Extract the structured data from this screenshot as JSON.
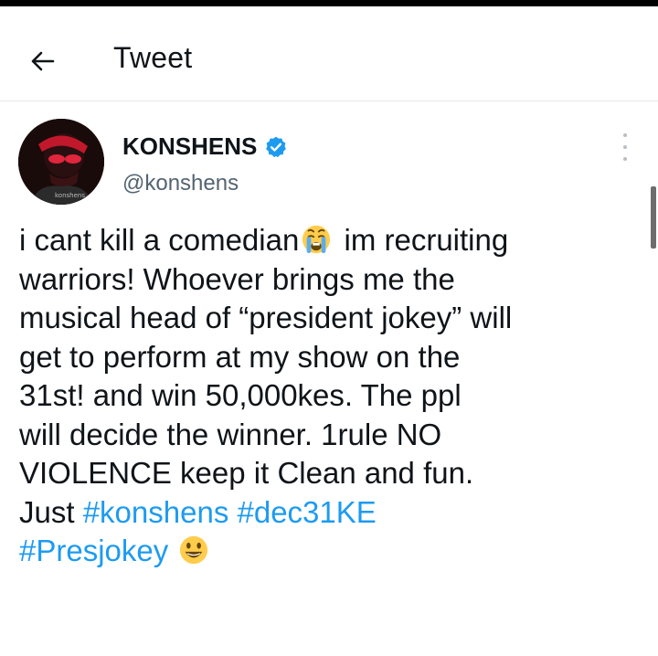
{
  "header": {
    "title": "Tweet"
  },
  "author": {
    "name": "KONSHENS",
    "handle": "@konshens",
    "verified": true
  },
  "tweet": {
    "line1_a": "i cant kill a comedian",
    "line1_b": " im recruiting",
    "line2": "warriors! Whoever brings me the",
    "line3": "musical head of “president jokey” will",
    "line4": "get to perform at my show on the",
    "line5": "31st! and win 50,000kes.  The ppl",
    "line6": "will decide the winner. 1rule NO",
    "line7": "VIOLENCE keep it Clean and fun.",
    "line8_text": "Just ",
    "hashtags": [
      "#konshens",
      "#dec31KE",
      "#Presjokey"
    ],
    "emojis": [
      "crying-face",
      "smiling-face"
    ]
  },
  "colors": {
    "link": "#1d9bf0",
    "verified": "#1d9bf0",
    "text": "#0f1419",
    "secondary": "#536471"
  },
  "icons": {
    "back": "arrow-left-icon",
    "more": "more-vertical-icon",
    "verified": "verified-badge-icon"
  }
}
